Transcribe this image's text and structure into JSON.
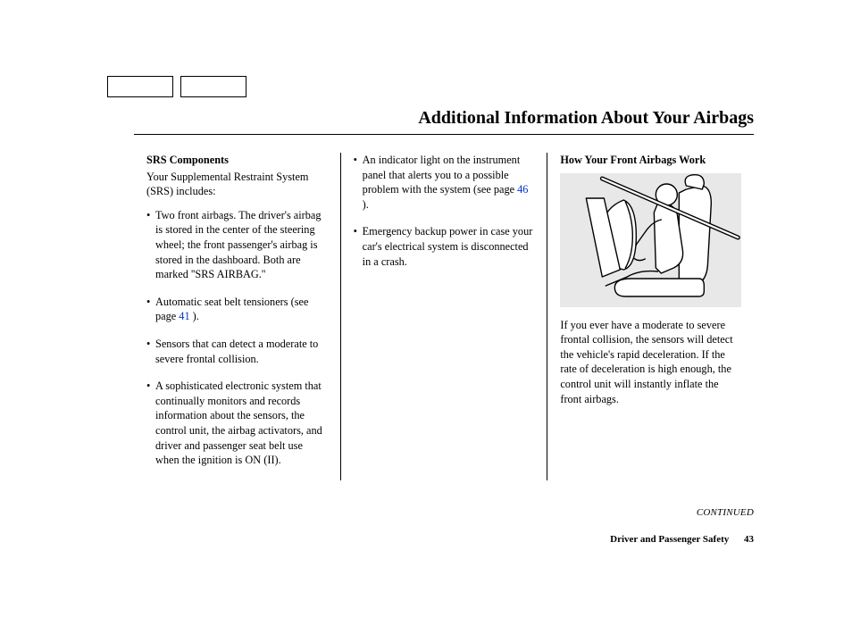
{
  "header": {
    "title": "Additional Information About Your Airbags"
  },
  "col1": {
    "heading": "SRS Components",
    "intro": "Your Supplemental Restraint System (SRS) includes:",
    "items": [
      "Two front airbags. The driver's airbag is stored in the center of the steering wheel; the front passenger's airbag is stored in the dashboard. Both are marked ''SRS AIRBAG.''",
      "Automatic seat belt tensioners (see page ",
      "Sensors that can detect a moderate to severe frontal collision.",
      "A sophisticated electronic system that continually monitors and records information about the sensors, the control unit, the airbag activators, and driver and passenger seat belt use when the ignition is ON (II)."
    ],
    "link1": "41",
    "item1_tail": " )."
  },
  "col2": {
    "items": [
      {
        "pre": "An indicator light on the instrument panel that alerts you to a possible problem with the system (see page ",
        "link": "46",
        "post": " )."
      },
      {
        "text": "Emergency backup power in case your car's electrical system is disconnected in a crash."
      }
    ]
  },
  "col3": {
    "heading": "How Your Front Airbags Work",
    "para": "If you ever have a moderate to severe frontal collision, the sensors will detect the vehicle's rapid deceleration. If the rate of deceleration is high enough, the control unit will instantly inflate the front airbags."
  },
  "continued": "CONTINUED",
  "footer": {
    "section": "Driver and Passenger Safety",
    "page": "43"
  }
}
